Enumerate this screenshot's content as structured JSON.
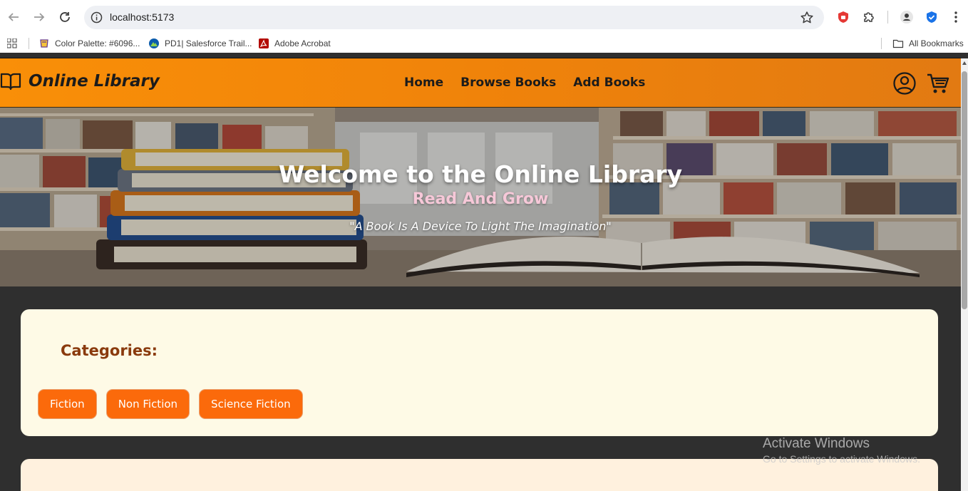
{
  "browser": {
    "url": "localhost:5173",
    "bookmarks": [
      {
        "label": "Color Palette: #6096..."
      },
      {
        "label": "PD1| Salesforce Trail..."
      },
      {
        "label": "Adobe Acrobat"
      }
    ],
    "all_bookmarks_label": "All Bookmarks"
  },
  "header": {
    "logo_text": "Online Library",
    "nav": [
      {
        "label": "Home"
      },
      {
        "label": "Browse Books"
      },
      {
        "label": "Add Books"
      }
    ],
    "accent_color": "#f98f08"
  },
  "hero": {
    "title": "Welcome to the Online Library",
    "subtitle": "Read And Grow",
    "quote": "\"A Book Is A Device To Light The Imagination\""
  },
  "categories": {
    "title": "Categories:",
    "items": [
      {
        "label": "Fiction"
      },
      {
        "label": "Non Fiction"
      },
      {
        "label": "Science Fiction"
      }
    ],
    "button_color": "#fb6a0b"
  },
  "watermark": {
    "line1": "Activate Windows",
    "line2": "Go to Settings to activate Windows."
  }
}
